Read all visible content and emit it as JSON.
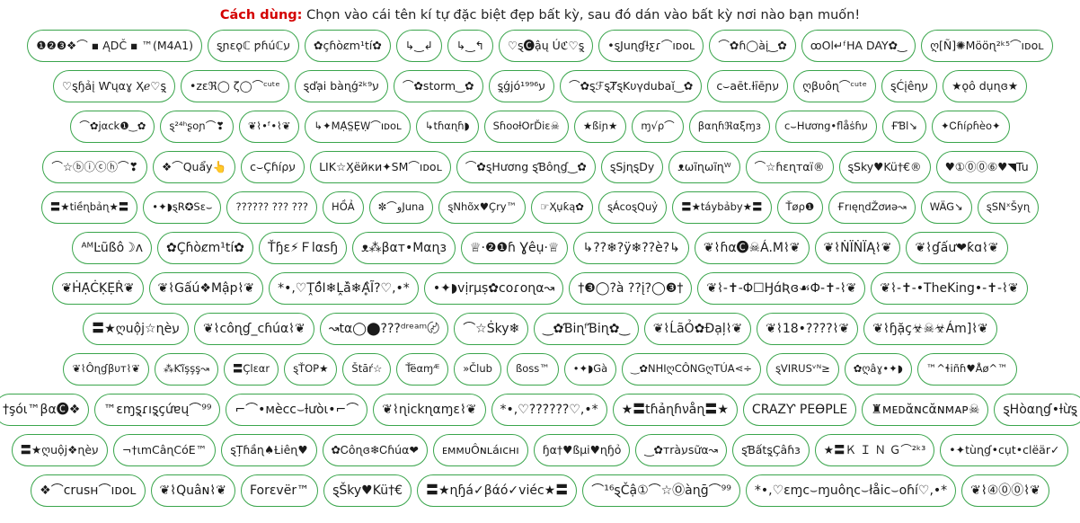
{
  "instruction": {
    "lead": "Cách dùng:",
    "text": " Chọn vào cái tên kí tự đặc biệt đẹp bất kỳ, sau đó dán vào bất kỳ nơi nào bạn muốn!"
  },
  "colors": {
    "chip_border": "#3aa54c",
    "instruction_lead": "#d40000",
    "text": "#1b1b1b",
    "background": "#ffffff"
  },
  "rows": [
    {
      "chips": [
        "❶❷❸❖⌒ ▪ ĄDČ ▪ ™(M4A1)",
        "ȿɲɛǫℂ ƿɦúℂע",
        "✿çɦòȼm¹tí✿",
        "↳‿↲",
        "↳‿↰",
        "♡ȿ🅒ậų Úℭ♡ȿ̤",
        "•ȿJuɳɠƚƹɾ⌒ıᴅᴏʟ",
        "⌒✿ɦ◯àį‿✿",
        "ꝏOl↵ᶠHA DAY✿‿",
        "ღ[Ñ]✺Mööɳ²ᵏ⁵⌒ıᴅᴏʟ"
      ]
    },
    {
      "chips": [
        "♡ȿɧảį Ⱳųαɣ Ҳℯ♡ȿ̤",
        "•zɛℜ◯ ζ◯⌒ᶜᵘᵗᵉ",
        "ȿďại bàɳǵ²ᵏ⁹ע",
        "⌒✿storm‿✿",
        "ȿ̤ǵјó¹⁹⁹⁶ע",
        "⌒✿ȿℱȿȾȿKυγdubaĭ‿✿",
        "ᴄ⌣aēt.ƚīēɲע",
        "ღβυôɳ⌒ᶜᵘᵗᵉ",
        "ȿĆįêɳע",
        "★ǫô dụɳɞ★"
      ]
    },
    {
      "chips": [
        "⌒✿jαᴄk❶‿✿",
        "ȿ²⁴ʰʂoɲ⌒❣",
        "❦⌇•ᶠ•⌇❦",
        "↳✦MẠ̇S̤Ẹ̇Ẉ⌒ıᴅᴏʟ",
        "↳tɦαɳɦ◗",
        "SɦooƚOrĎiɛ☠",
        "★ßiɲ★",
        "ɱ√ρ⌒",
        "βαɳɦℜαξɱɜ",
        "ᴄ⌣Hương•ﬂåṡɦע",
        "ҒƁl↘",
        "✦Ꮯɦíρɦèᴏ✦"
      ]
    },
    {
      "chips": [
        "⌒☆ⓑⓘⓒⓗ⌒❣",
        "❖⌒Quẩy👆",
        "ᴄ⌣Çɦíρע",
        "LIK☆Ӽëйки✦SM⌒ıᴅᴏʟ",
        "⌒✿ȿHương ȿƁôɳɠ‿✿",
        "ȿSjɳȿDy",
        "ᴥωĩɳωĩɳᵂ",
        "⌒☆ɦɛɳтαї®",
        "ȿSky♥Kü†€®",
        "♥①⓪⓪⑥♥◥Tu"
      ]
    },
    {
      "chips": [
        "〓★tiềɳbảɳ★〓",
        "•✦◗ȿR✪Sɛ⌣",
        "?????? ??? ???",
        "HỒẢ",
        "✼⌒ﻭJuna",
        "ȿNhõx♥Çry™",
        "☞Ҳụƙą✿",
        "ȿÁcᴏȿQuỷ",
        "〓★táybảby★〓",
        "Ťøρ❶",
        "ҒrıęɳdŽơиǝ↝",
        "WÄG↘",
        "ȿSNˣŠyɳ"
      ]
    },
    {
      "chips": [
        "ᴬᴹĿũßô☽ᴧ",
        "✿Çɦòȼm¹tí✿",
        "Ťɧɛ⚡Ｆlαsɧ",
        "ᴥ⁂βαт•Mαɳɜ",
        "♕·❷❶ɦ Ɣêụ·♕",
        "↳??❄?ÿ❄??è?↳",
        "❦⌇ɦα🅒☠Á.M⌇❦",
        "❦⌇ṄÏṄÏĄ⌇❦",
        "❦⌇ɠấư❤ƙɑ⌇❦"
      ]
    },
    {
      "chips": [
        "❦ḢẠ̇ĊḲẸ̇Ṙ❦",
        "❦⌇Gấú❖Mập⌇❦",
        "*•,♡Ṱồ̂Ι❄Ḽà̂❄Ḁ̂Ĩ?♡,•*",
        "•✦◗vịrµṣ✿ᴄoɾoɳα↝",
        "†❸◯?à ??į?◯❸†",
        "❦⌇-✝-Փ☐Ӈɑ́Ʀɞ☙Փ-✝-⌇❦",
        "❦⌇-✝-•TheKing•-✝-⌇❦"
      ]
    },
    {
      "chips": [
        "〓★ღuộj☆ɳèע",
        "❦⌇ᴄôɳɠ_cɦúα⌇❦",
        "↝tα◯⬤???ᵈʳᵉᵃᵐ〄",
        "⌒☆Ṡky❄",
        "‿✿ƁiɳᶠƁiɳ✿‿",
        "❦⌇ĹãỎ✿Đạļ⌇❦",
        "❦⌇18•????⌇❦",
        "❦⌇ɧặç☣☠☣Ám]⌇❦"
      ]
    },
    {
      "chips": [
        "❦⌇Ôɳɠβυт⌇❦",
        "⁂Ƙĩşşş̧↝",
        "〓Çlɛαr",
        "ȿŤOP★",
        "Štāŕ☆",
        "Ťëαɱᴭ",
        "»Člub",
        "ßoss™",
        "•✦◗Gà",
        "‿✿NHIღCÔNGღTÚA⋖÷",
        "ȿVIRUSᵛᴺ≥",
        "✿ღâɣ•✦◗",
        "™^ɬiñɦ♥Åø^™"
      ]
    },
    {
      "chips": [
        "†şóι™βα🅒❖",
        "™ɛɱȿ̤ɾıȿ̤çứɐų⌒⁹⁹",
        "⌐⌒•ᴍèᴄᴄ⌣ƚưòι•⌐⌒",
        "❦⌇ɳickɳαɱɛ⌇❦",
        "*•,♡??????♡,•*",
        "★〓tɦảɳɦνåɳ〓★",
        "CRAZƳ PEӨPLE",
        "♜ᴍᴇᴅᾰɴᴄᾰɴᴍᴀᴘ☠",
        "ȿHòαɳɠ•ƚừȿ̤"
      ]
    },
    {
      "chips": [
        "〓★ღuộj❖ɳèע",
        "¬†ιmCâɳCóE™",
        "ȿȚɦầɳ♠Ƚiêɳ♥",
        "✿Ꮯôɳɞ❄Ꮯɦúα❤",
        "ᴇᴍᴍᴜÔɴʟáıᴄʜı",
        "ɧα†♥ßµi♥ɳɧỏ",
        "‿✿тràעsữα↝",
        "ȿƁấtȿ̤Çâɦɜ",
        "★〓Ｋ Ｉ Ｎ Ｇ⌒²ᵏ³",
        "•✦tùɳɠ•ᴄụt•ᴄlëär✓"
      ]
    },
    {
      "chips": [
        "❖⌒ᴄrusʜ⌒ıᴅᴏʟ",
        "❦⌇Quâɴ⌇❦",
        "Forɛvër™",
        "ȿŠky♥Kü†€",
        "〓★ɳɧá✓βάó✓viéᴄ★〓",
        "⌒¹⁶ȿČậ①⌒☆Ⓞàɳḡ⌒⁹⁹",
        "*•,♡ɛɱᴄ⌣ɱuôɳᴄ⌣łåiᴄ⌣oɦí♡,•*",
        "❦⌇④⓪⓪⌇❦"
      ]
    }
  ]
}
